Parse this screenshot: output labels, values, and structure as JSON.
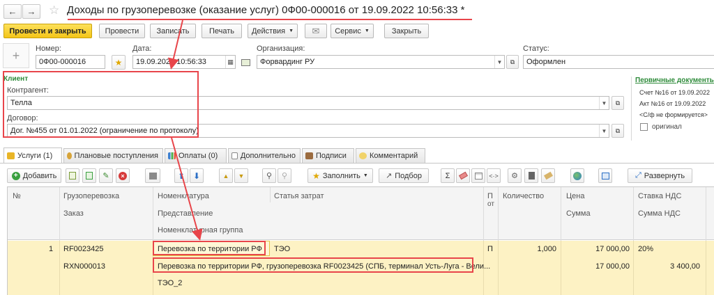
{
  "window": {
    "title": "Доходы по грузоперевозке (оказание услуг) 0Ф00-000016 от 19.09.2022 10:56:33",
    "modified_marker": "*"
  },
  "toolbar": {
    "post_close": "Провести и закрыть",
    "post": "Провести",
    "write": "Записать",
    "print": "Печать",
    "actions": "Действия",
    "service": "Сервис",
    "close": "Закрыть"
  },
  "header": {
    "number_label": "Номер:",
    "number_value": "0Ф00-000016",
    "date_label": "Дата:",
    "date_value": "19.09.2022 10:56:33",
    "org_label": "Организация:",
    "org_value": "Форвардинг РУ",
    "status_label": "Статус:",
    "status_value": "Оформлен"
  },
  "client": {
    "section_title": "Клиент",
    "counterparty_label": "Контрагент:",
    "counterparty_value": "Телла",
    "contract_label": "Договор:",
    "contract_value": "Дог. №455 от 01.01.2022 (ограничение по протоколу)"
  },
  "primary_docs": {
    "title": "Первичные документы",
    "invoice": "Счет №16 от 19.09.2022",
    "act": "Акт №16 от 19.09.2022",
    "sf": "<С/ф не формируется>",
    "original_label": "оригинал"
  },
  "tabs": [
    {
      "label": "Услуги (1)"
    },
    {
      "label": "Плановые поступления"
    },
    {
      "label": "Оплаты (0)"
    },
    {
      "label": "Дополнительно"
    },
    {
      "label": "Подписи"
    },
    {
      "label": "Комментарий"
    }
  ],
  "table_toolbar": {
    "add": "Добавить",
    "fill": "Заполнить",
    "select": "Подбор",
    "expand": "Развернуть"
  },
  "columns": {
    "num": "№",
    "cargo": "Грузоперевозка",
    "order": "Заказ",
    "nomenclature": "Номенклатура",
    "representation": "Представление",
    "nomenclature_group": "Номенклатурная группа",
    "cost_item": "Статья затрат",
    "p": "П",
    "ot": "от",
    "quantity": "Количество",
    "price": "Цена",
    "sum": "Сумма",
    "vat_rate": "Ставка НДС",
    "vat_sum": "Сумма НДС"
  },
  "row": {
    "num": "1",
    "cargo": "RF0023425",
    "order": "RXN000013",
    "nomenclature": "Перевозка по территории РФ",
    "representation": "Перевозка по территории РФ, грузоперевозка RF0023425 (СПБ, терминал Усть-Луга - Вели...",
    "nomenclature_group": "ТЭО_2",
    "cost_item": "ТЭО",
    "p": "П",
    "quantity": "1,000",
    "price": "17 000,00",
    "sum": "17 000,00",
    "vat_rate": "20%",
    "vat_sum": "3 400,00"
  },
  "colors": {
    "accent_yellow": "#f4c518",
    "row_highlight": "#fdf2c4",
    "annotation_red": "#e8454a",
    "green_link": "#2e8b3a"
  }
}
